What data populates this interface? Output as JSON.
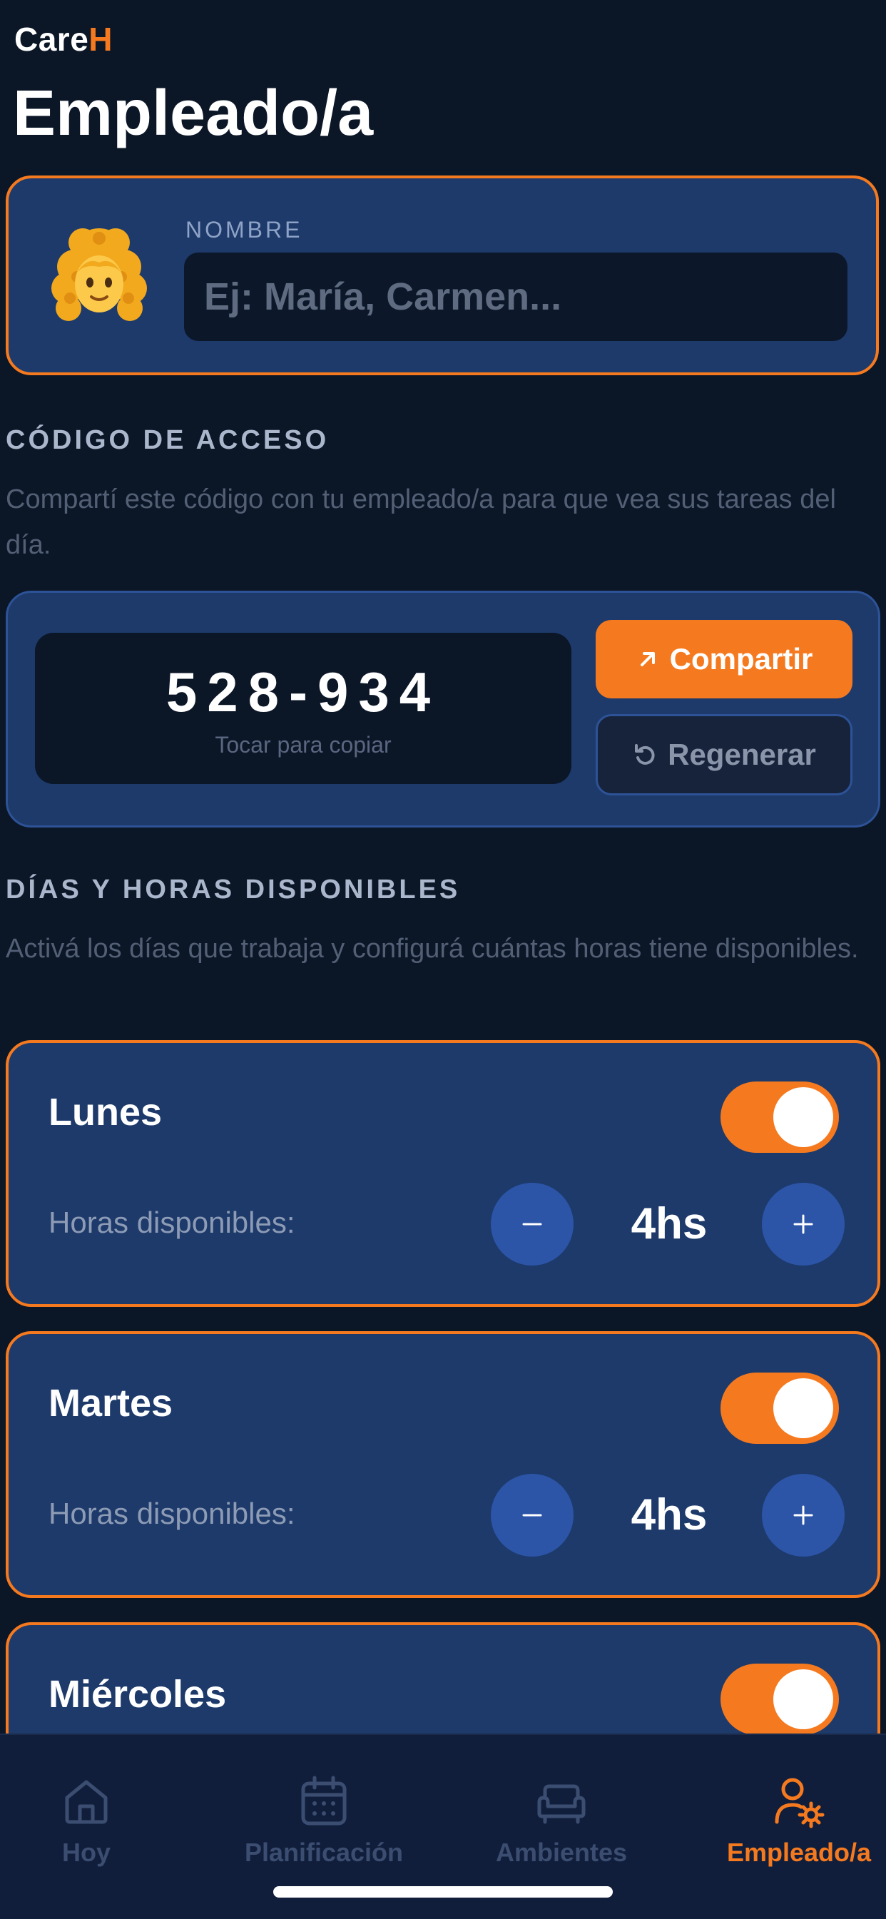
{
  "brand": {
    "prefix": "Care",
    "accent_letter": "H"
  },
  "header": {
    "title": "Empleado/a"
  },
  "profile": {
    "avatar_emoji": "👩‍🦱",
    "name_label": "NOMBRE",
    "name_placeholder": "Ej: María, Carmen...",
    "name_value": ""
  },
  "access_code": {
    "title": "CÓDIGO DE ACCESO",
    "description": "Compartí este código con tu empleado/a para que vea sus tareas del día.",
    "code": "528-934",
    "copy_hint": "Tocar para copiar",
    "share_label": "Compartir",
    "regenerate_label": "Regenerar"
  },
  "availability": {
    "title": "DÍAS Y HORAS DISPONIBLES",
    "description": "Activá los días que trabaja y configurá cuántas horas tiene disponibles.",
    "hours_label": "Horas disponibles:",
    "days": [
      {
        "name": "Lunes",
        "enabled": true,
        "hours": "4hs"
      },
      {
        "name": "Martes",
        "enabled": true,
        "hours": "4hs"
      },
      {
        "name": "Miércoles",
        "enabled": true,
        "hours": ""
      }
    ]
  },
  "nav": {
    "items": [
      {
        "label": "Hoy",
        "icon": "home-icon",
        "active": false
      },
      {
        "label": "Planificación",
        "icon": "calendar-icon",
        "active": false
      },
      {
        "label": "Ambientes",
        "icon": "sofa-icon",
        "active": false
      },
      {
        "label": "Empleado/a",
        "icon": "user-settings-icon",
        "active": true
      }
    ]
  },
  "colors": {
    "background": "#0b1627",
    "card": "#1d3a6b",
    "accent": "#f57a1f",
    "stepper": "#2c55a8",
    "nav_background": "#101e3b"
  }
}
